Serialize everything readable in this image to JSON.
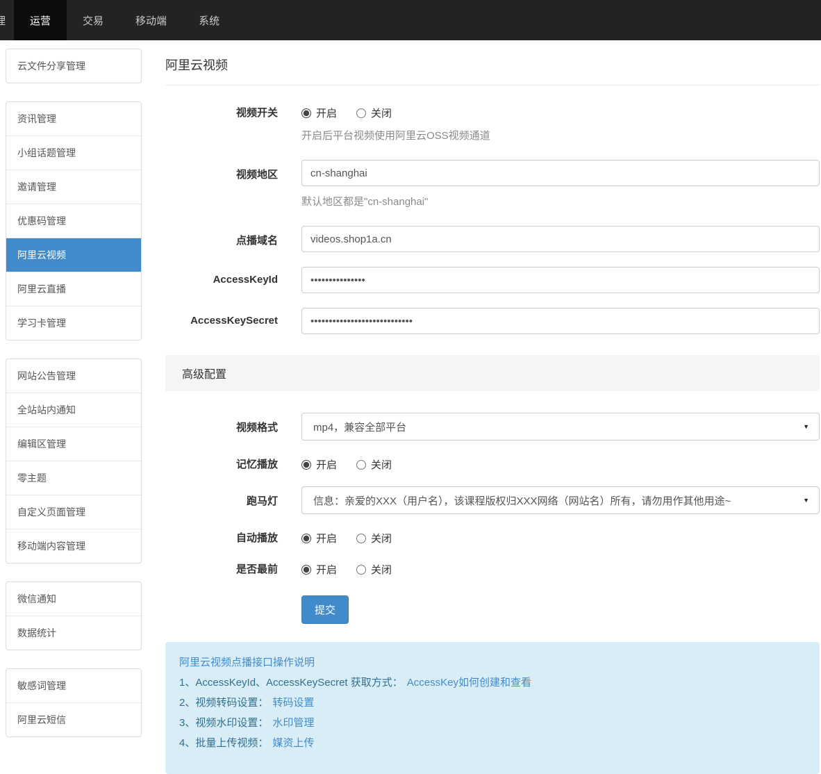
{
  "colors": {
    "accent": "#428bca",
    "topbar_bg": "#232323",
    "topbar_active_bg": "#0c0c0c",
    "section_bar_bg": "#f5f5f5",
    "info_box_bg": "#d9edf7"
  },
  "topnav": {
    "items": [
      {
        "label": "理",
        "active": false,
        "partial": true
      },
      {
        "label": "运营",
        "active": true
      },
      {
        "label": "交易",
        "active": false
      },
      {
        "label": "移动端",
        "active": false
      },
      {
        "label": "系统",
        "active": false
      }
    ]
  },
  "sidebar": {
    "groups": [
      {
        "items": [
          {
            "label": "云文件分享管理",
            "active": false
          }
        ]
      },
      {
        "items": [
          {
            "label": "资讯管理",
            "active": false
          },
          {
            "label": "小组话题管理",
            "active": false
          },
          {
            "label": "邀请管理",
            "active": false
          },
          {
            "label": "优惠码管理",
            "active": false
          },
          {
            "label": "阿里云视频",
            "active": true
          },
          {
            "label": "阿里云直播",
            "active": false
          },
          {
            "label": "学习卡管理",
            "active": false
          }
        ]
      },
      {
        "items": [
          {
            "label": "网站公告管理",
            "active": false
          },
          {
            "label": "全站站内通知",
            "active": false
          },
          {
            "label": "编辑区管理",
            "active": false
          },
          {
            "label": "零主题",
            "active": false
          },
          {
            "label": "自定义页面管理",
            "active": false
          },
          {
            "label": "移动端内容管理",
            "active": false
          }
        ]
      },
      {
        "items": [
          {
            "label": "微信通知",
            "active": false
          },
          {
            "label": "数据统计",
            "active": false
          }
        ]
      },
      {
        "items": [
          {
            "label": "敏感词管理",
            "active": false
          },
          {
            "label": "阿里云短信",
            "active": false
          }
        ]
      }
    ]
  },
  "main": {
    "title": "阿里云视频",
    "rows": {
      "video_switch": {
        "label": "视频开关",
        "options": [
          "开启",
          "关闭"
        ],
        "selected": "开启",
        "hint": "开启后平台视频使用阿里云OSS视频通道"
      },
      "region": {
        "label": "视频地区",
        "value": "cn-shanghai",
        "hint": "默认地区都是\"cn-shanghai\""
      },
      "play_domain": {
        "label": "点播域名",
        "value": "videos.shop1a.cn"
      },
      "access_key_id": {
        "label": "AccessKeyId",
        "value": "•••••••••••••••"
      },
      "access_key_secret": {
        "label": "AccessKeySecret",
        "value": "••••••••••••••••••••••••••••"
      },
      "advanced_section_title": "高级配置",
      "video_format": {
        "label": "视频格式",
        "value": "mp4，兼容全部平台"
      },
      "memory_play": {
        "label": "记忆播放",
        "options": [
          "开启",
          "关闭"
        ],
        "selected": "开启"
      },
      "marquee": {
        "label": "跑马灯",
        "value": "信息：亲爱的XXX（用户名），该课程版权归XXX网络（网站名）所有，请勿用作其他用途~"
      },
      "auto_play": {
        "label": "自动播放",
        "options": [
          "开启",
          "关闭"
        ],
        "selected": "开启"
      },
      "always_front": {
        "label": "是否最前",
        "options": [
          "开启",
          "关闭"
        ],
        "selected": "开启"
      },
      "submit_label": "提交"
    },
    "info": {
      "title": "阿里云视频点播接口操作说明",
      "lines": [
        {
          "text": "1、AccessKeyId、AccessKeySecret 获取方式：",
          "link": "AccessKey如何创建和查看"
        },
        {
          "text": "2、视频转码设置：",
          "link": "转码设置"
        },
        {
          "text": "3、视频水印设置：",
          "link": "水印管理"
        },
        {
          "text": "4、批量上传视频：",
          "link": "媒资上传"
        }
      ]
    }
  }
}
